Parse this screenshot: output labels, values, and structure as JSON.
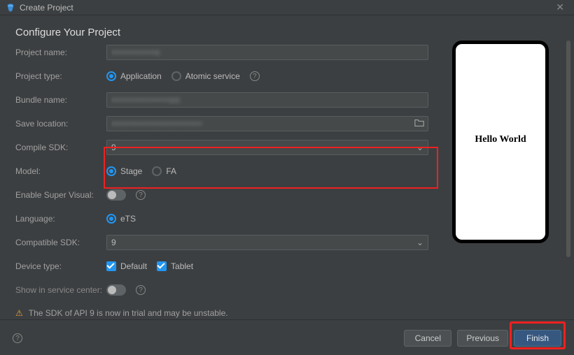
{
  "window": {
    "title": "Create Project",
    "heading": "Configure Your Project"
  },
  "labels": {
    "project_name": "Project name:",
    "project_type": "Project type:",
    "bundle_name": "Bundle name:",
    "save_location": "Save location:",
    "compile_sdk": "Compile SDK:",
    "model": "Model:",
    "enable_super_visual": "Enable Super Visual:",
    "language": "Language:",
    "compatible_sdk": "Compatible SDK:",
    "device_type": "Device type:",
    "show_service_center": "Show in service center:"
  },
  "values": {
    "project_name": "••••••••••••n",
    "bundle_name": "••••••••••••••••on",
    "save_location": "•••••••••••••••••••••••••",
    "compile_sdk": "9",
    "compatible_sdk": "9"
  },
  "options": {
    "project_type": {
      "application": "Application",
      "atomic_service": "Atomic service"
    },
    "model": {
      "stage": "Stage",
      "fa": "FA"
    },
    "language": {
      "ets": "eTS"
    },
    "device_type": {
      "default": "Default",
      "tablet": "Tablet"
    }
  },
  "warning": "The SDK of API 9 is now in trial and may be unstable.",
  "buttons": {
    "cancel": "Cancel",
    "previous": "Previous",
    "finish": "Finish"
  },
  "preview": {
    "text": "Hello World"
  },
  "icons": {
    "chevron_down": "⌄",
    "help": "?",
    "warn": "⚠",
    "close": "✕"
  }
}
